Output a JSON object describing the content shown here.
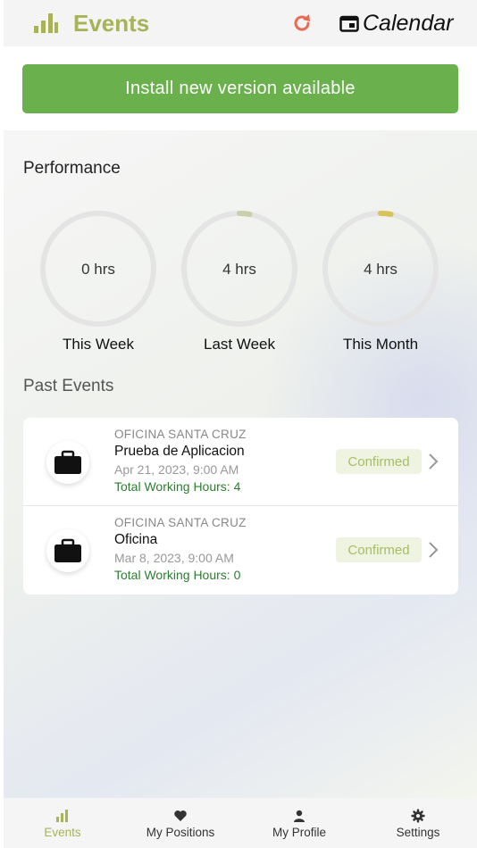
{
  "header": {
    "title": "Events",
    "calendar_label": "Calendar",
    "icons": {
      "logo": "bar-chart-icon",
      "refresh": "refresh-icon",
      "calendar": "calendar-icon"
    },
    "colors": {
      "title": "#a7b356",
      "refresh": "#e86a55"
    }
  },
  "install_banner": {
    "label": "Install new version available",
    "color": "#6ab04c"
  },
  "performance": {
    "title": "Performance",
    "rings": [
      {
        "value": "0 hrs",
        "label": "This Week",
        "progress": 0.0,
        "color": "#c9cfaa"
      },
      {
        "value": "4 hrs",
        "label": "Last Week",
        "progress": 0.03,
        "color": "#c9cfaa"
      },
      {
        "value": "4 hrs",
        "label": "This Month",
        "progress": 0.03,
        "color": "#d8c35a"
      }
    ]
  },
  "past_events": {
    "title": "Past Events",
    "items": [
      {
        "org": "OFICINA SANTA CRUZ",
        "name": "Prueba de Aplicacion",
        "date": "Apr 21, 2023, 9:00 AM",
        "hours": "Total Working Hours: 4",
        "status": "Confirmed",
        "icon": "briefcase-icon"
      },
      {
        "org": "OFICINA SANTA CRUZ",
        "name": "Oficina",
        "date": "Mar 8, 2023, 9:00 AM",
        "hours": "Total Working Hours: 0",
        "status": "Confirmed",
        "icon": "briefcase-icon"
      }
    ]
  },
  "bottom_nav": {
    "items": [
      {
        "label": "Events",
        "icon": "bar-chart-icon",
        "active": true
      },
      {
        "label": "My Positions",
        "icon": "heart-icon",
        "active": false
      },
      {
        "label": "My Profile",
        "icon": "person-icon",
        "active": false
      },
      {
        "label": "Settings",
        "icon": "gear-icon",
        "active": false
      }
    ],
    "active_color": "#a7b356"
  }
}
